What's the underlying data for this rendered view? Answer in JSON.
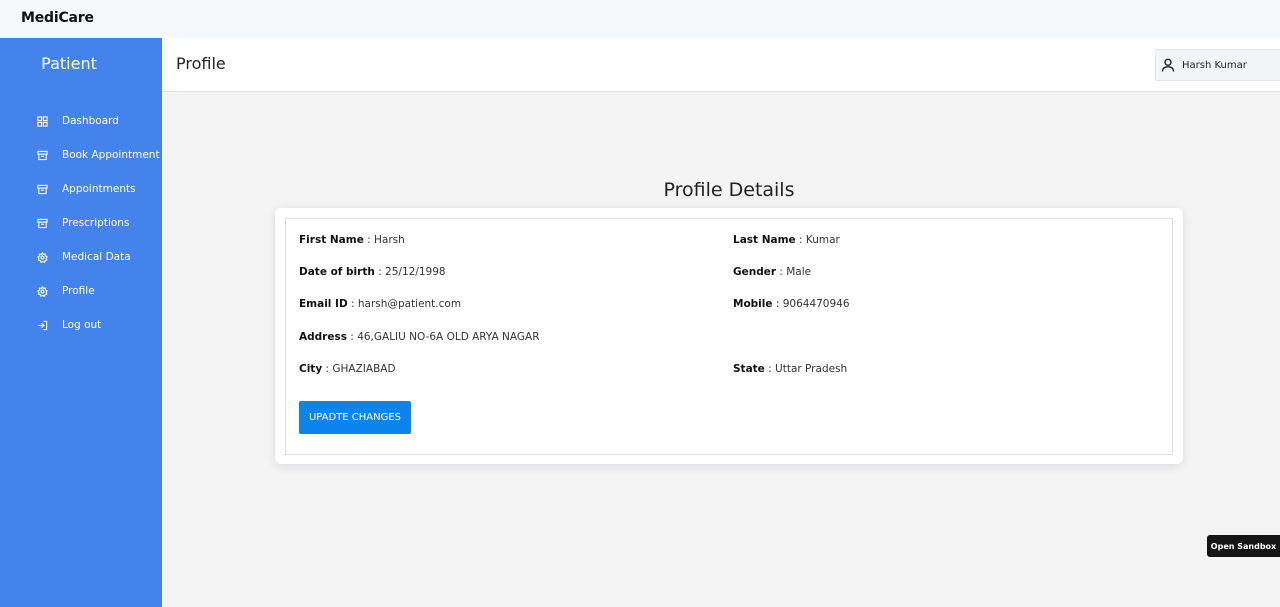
{
  "app": {
    "brand": "MediCare"
  },
  "sidebar": {
    "title": "Patient",
    "items": [
      {
        "label": "Dashboard",
        "icon": "grid-icon"
      },
      {
        "label": "Book Appointment",
        "icon": "archive-icon"
      },
      {
        "label": "Appointments",
        "icon": "archive-icon"
      },
      {
        "label": "Prescriptions",
        "icon": "archive-icon"
      },
      {
        "label": "Medical Data",
        "icon": "gear-icon"
      },
      {
        "label": "Profile",
        "icon": "gear-icon"
      },
      {
        "label": "Log out",
        "icon": "logout-icon"
      }
    ]
  },
  "header": {
    "title": "Profile",
    "user_name": "Harsh Kumar",
    "user_icon": "user-icon"
  },
  "profile": {
    "section_title": "Profile Details",
    "first_name": {
      "label": "First Name",
      "value": "Harsh"
    },
    "last_name": {
      "label": "Last Name",
      "value": "Kumar"
    },
    "dob": {
      "label": "Date of birth",
      "value": "25/12/1998"
    },
    "gender": {
      "label": "Gender",
      "value": "Male"
    },
    "email": {
      "label": "Email ID",
      "value": "harsh@patient.com"
    },
    "mobile": {
      "label": "Mobile",
      "value": "9064470946"
    },
    "address": {
      "label": "Address",
      "value": "46,GALIU NO-6A OLD ARYA NAGAR"
    },
    "city": {
      "label": "City",
      "value": "GHAZIABAD"
    },
    "state": {
      "label": "State",
      "value": "Uttar Pradesh"
    },
    "update_label": "UPADTE CHANGES"
  },
  "sandbox": {
    "label": "Open Sandbox"
  },
  "colors": {
    "sidebar": "#4483ec",
    "button": "#0b84ee",
    "background": "#f4f4f5"
  }
}
